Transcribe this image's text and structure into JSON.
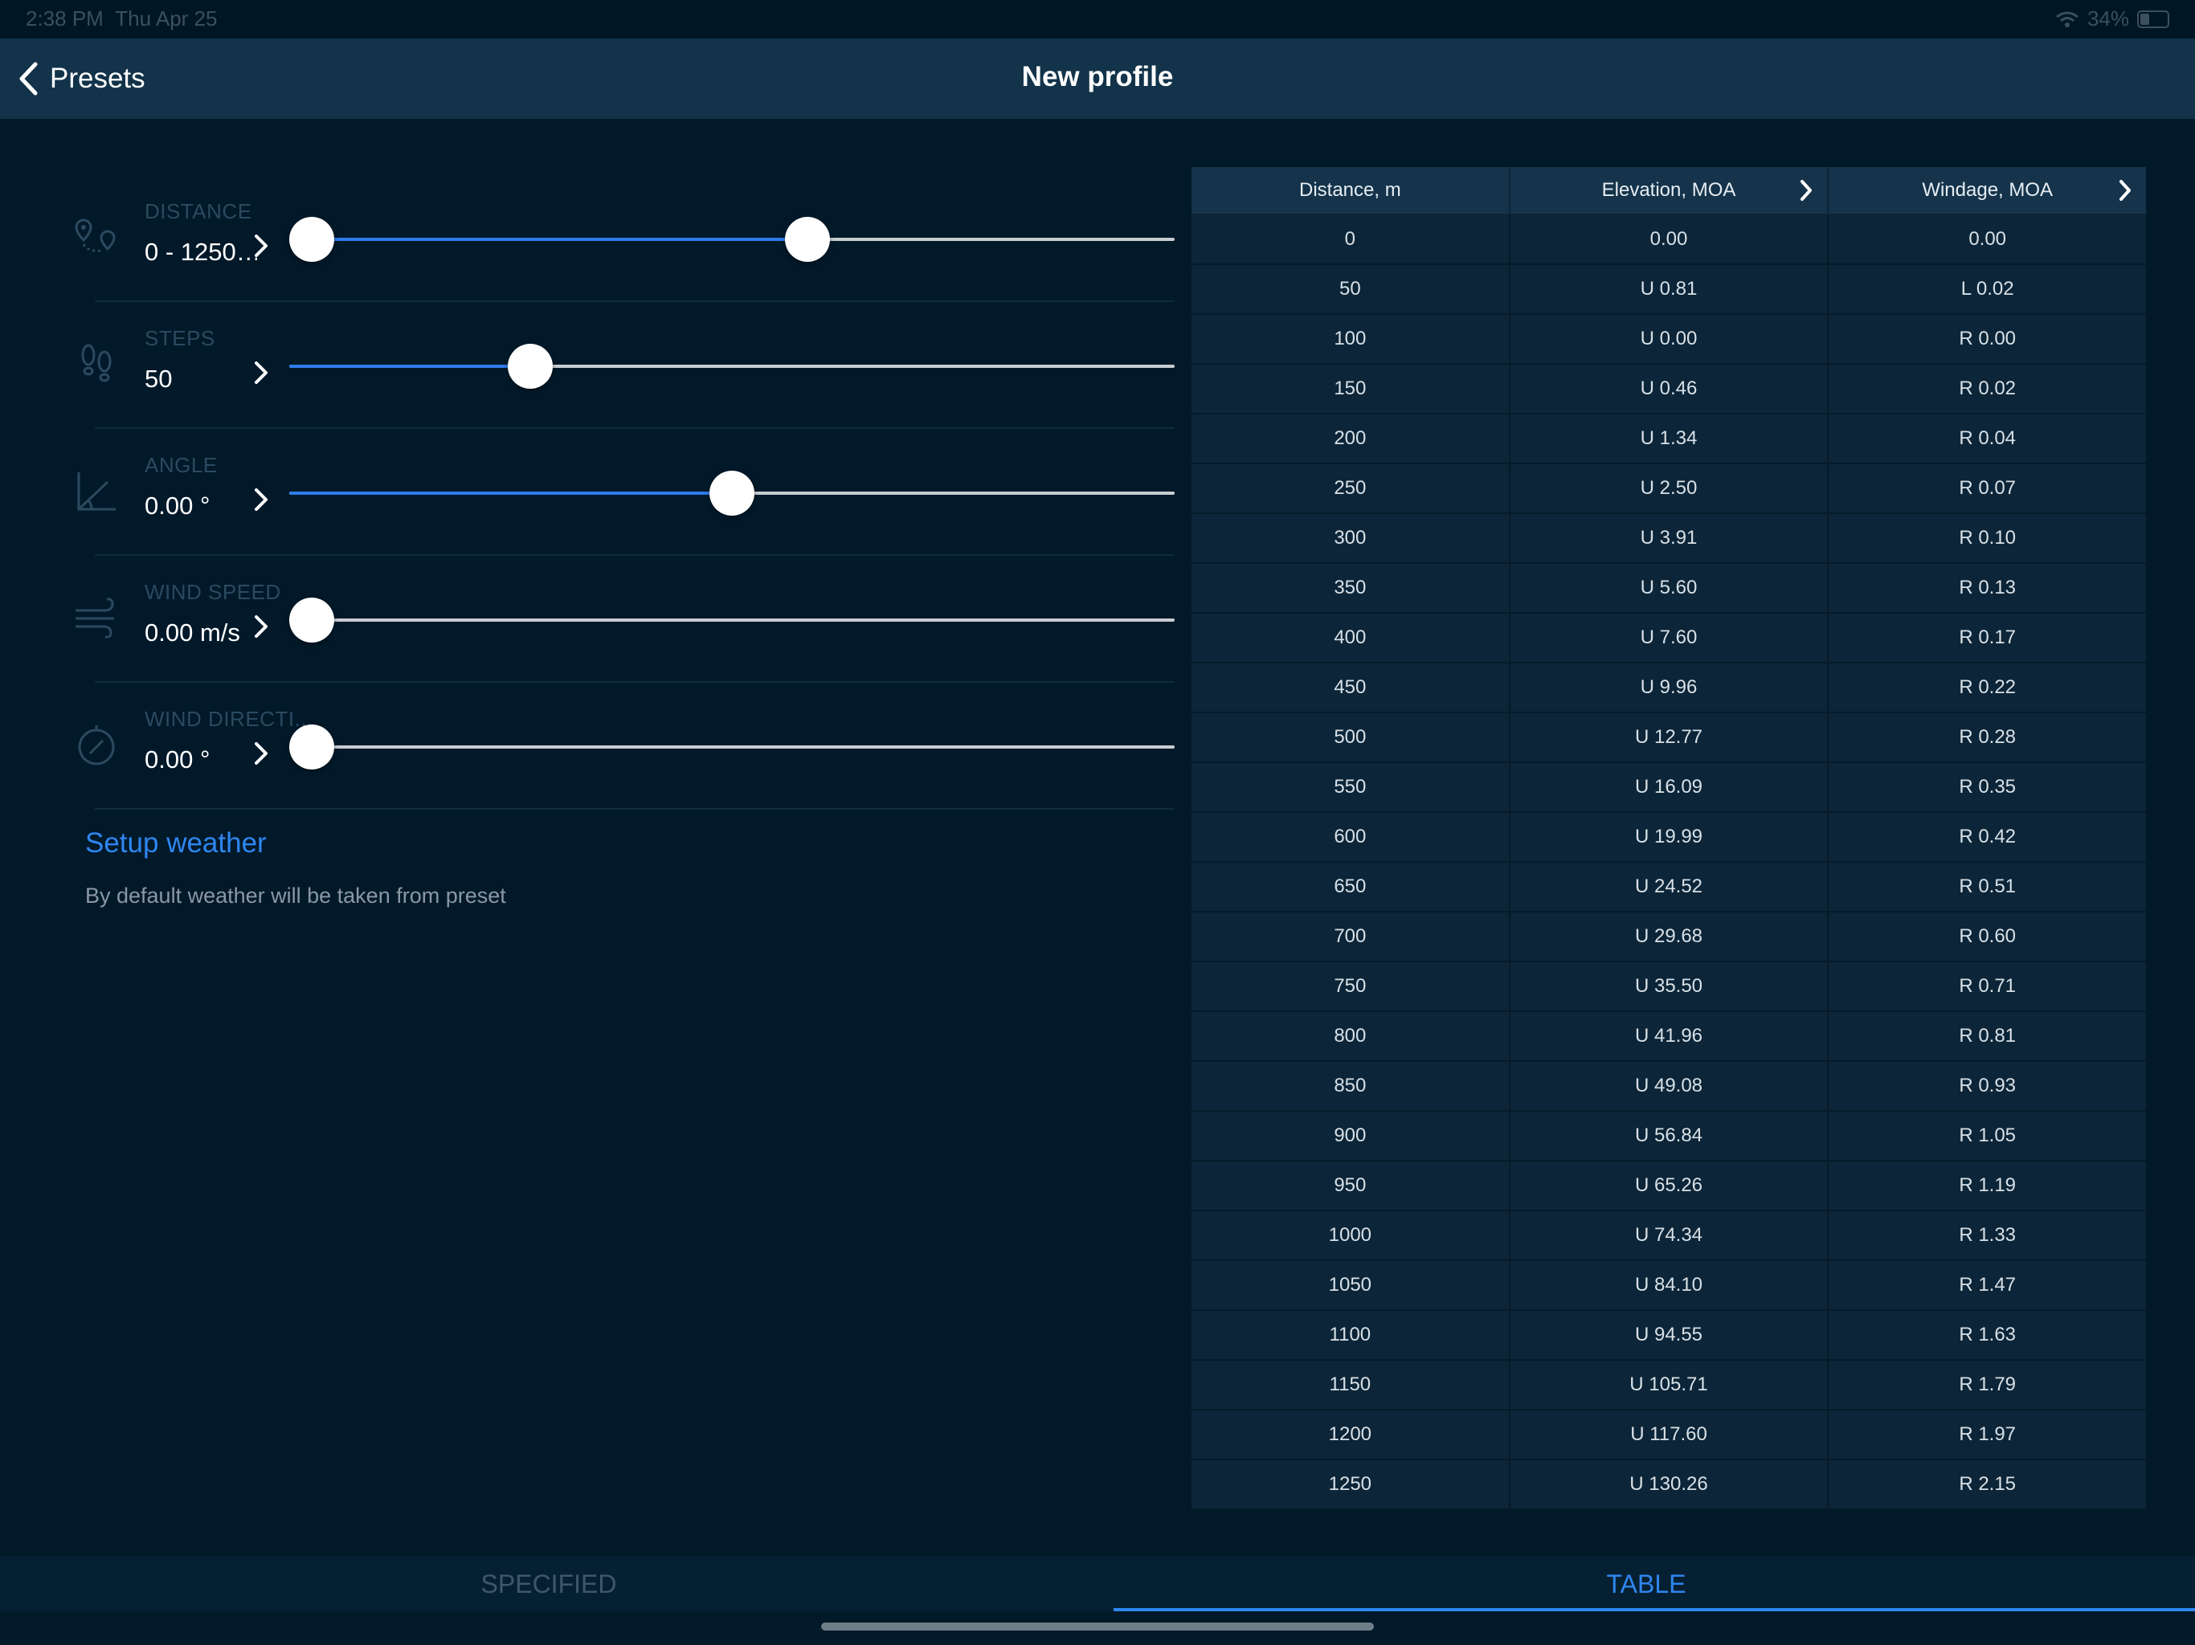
{
  "status_bar": {
    "time": "2:38 PM",
    "date": "Thu Apr 25",
    "battery": "34%"
  },
  "nav": {
    "back_label": "Presets",
    "title": "New profile"
  },
  "params": [
    {
      "id": "distance",
      "label": "DISTANCE",
      "value": "0 - 1250…",
      "icon": "map-pins-icon",
      "slider": {
        "range": true,
        "low": 0.0,
        "high": 0.59
      }
    },
    {
      "id": "steps",
      "label": "STEPS",
      "value": "50",
      "icon": "footprints-icon",
      "slider": {
        "range": false,
        "level": 0.26
      }
    },
    {
      "id": "angle",
      "label": "ANGLE",
      "value": "0.00 °",
      "icon": "angle-icon",
      "slider": {
        "range": false,
        "level": 0.5
      }
    },
    {
      "id": "wind-speed",
      "label": "WIND SPEED",
      "value": "0.00 m/s",
      "icon": "wind-icon",
      "slider": {
        "range": false,
        "level": 0.0
      }
    },
    {
      "id": "wind-direction",
      "label": "WIND DIRECTI...",
      "value": "0.00 °",
      "icon": "compass-icon",
      "slider": {
        "range": false,
        "level": 0.0
      }
    }
  ],
  "weather": {
    "link": "Setup weather",
    "note": "By default weather will be taken from preset"
  },
  "table": {
    "headers": [
      "Distance, m",
      "Elevation, MOA",
      "Windage, MOA"
    ],
    "rows": [
      [
        "0",
        "0.00",
        "0.00"
      ],
      [
        "50",
        "U 0.81",
        "L 0.02"
      ],
      [
        "100",
        "U 0.00",
        "R 0.00"
      ],
      [
        "150",
        "U 0.46",
        "R 0.02"
      ],
      [
        "200",
        "U 1.34",
        "R 0.04"
      ],
      [
        "250",
        "U 2.50",
        "R 0.07"
      ],
      [
        "300",
        "U 3.91",
        "R 0.10"
      ],
      [
        "350",
        "U 5.60",
        "R 0.13"
      ],
      [
        "400",
        "U 7.60",
        "R 0.17"
      ],
      [
        "450",
        "U 9.96",
        "R 0.22"
      ],
      [
        "500",
        "U 12.77",
        "R 0.28"
      ],
      [
        "550",
        "U 16.09",
        "R 0.35"
      ],
      [
        "600",
        "U 19.99",
        "R 0.42"
      ],
      [
        "650",
        "U 24.52",
        "R 0.51"
      ],
      [
        "700",
        "U 29.68",
        "R 0.60"
      ],
      [
        "750",
        "U 35.50",
        "R 0.71"
      ],
      [
        "800",
        "U 41.96",
        "R 0.81"
      ],
      [
        "850",
        "U 49.08",
        "R 0.93"
      ],
      [
        "900",
        "U 56.84",
        "R 1.05"
      ],
      [
        "950",
        "U 65.26",
        "R 1.19"
      ],
      [
        "1000",
        "U 74.34",
        "R 1.33"
      ],
      [
        "1050",
        "U 84.10",
        "R 1.47"
      ],
      [
        "1100",
        "U 94.55",
        "R 1.63"
      ],
      [
        "1150",
        "U 105.71",
        "R 1.79"
      ],
      [
        "1200",
        "U 117.60",
        "R 1.97"
      ],
      [
        "1250",
        "U 130.26",
        "R 2.15"
      ]
    ]
  },
  "tabs": {
    "specified": "SPECIFIED",
    "table": "TABLE",
    "active": "table"
  },
  "colors": {
    "accent": "#2f86f0",
    "background": "#02192a",
    "nav": "#12334a"
  }
}
